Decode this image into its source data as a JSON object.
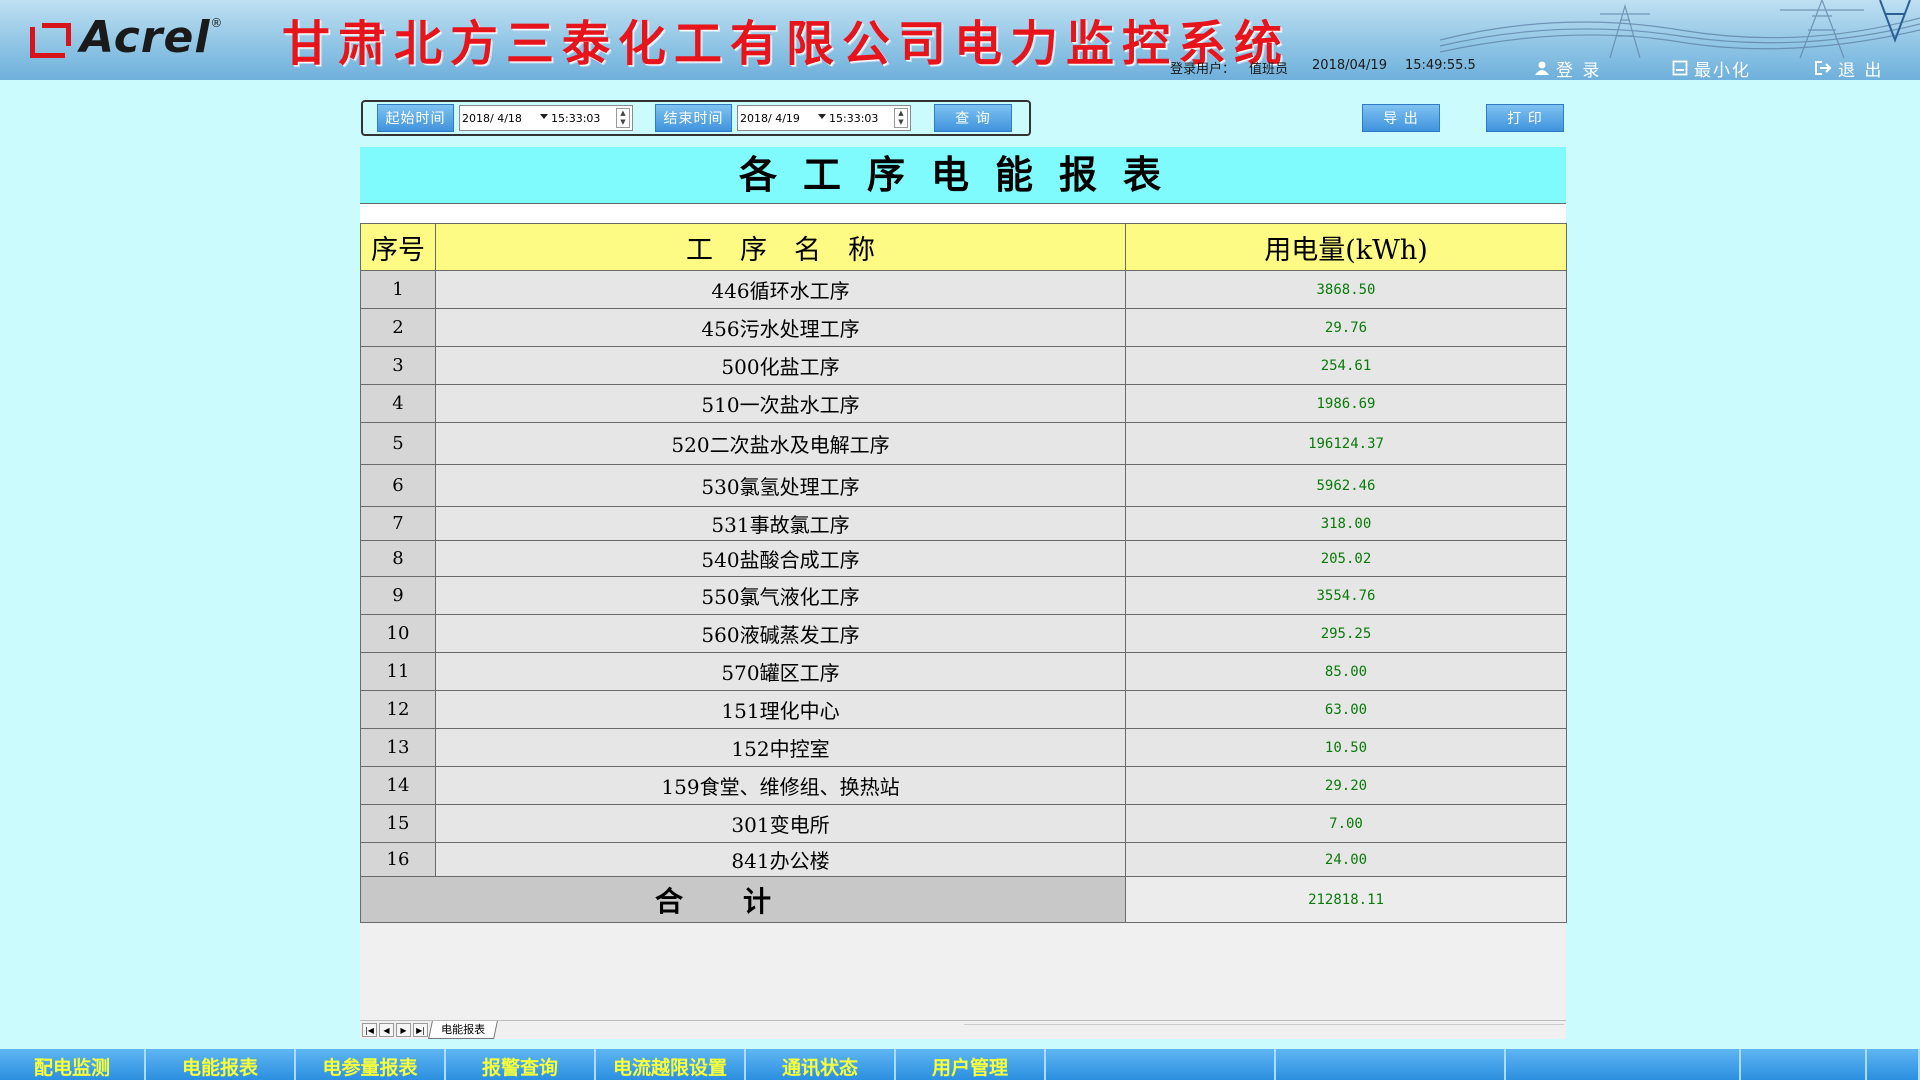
{
  "header": {
    "logo_text": "Acrel",
    "logo_reg": "®",
    "system_title": "甘肃北方三泰化工有限公司电力监控系统",
    "user_label": "登录用户：",
    "user_name": "值班员",
    "date": "2018/04/19",
    "time": "15:49:55.5",
    "login_label": "登 录",
    "minimize_label": "最小化",
    "exit_label": "退 出"
  },
  "toolbar": {
    "start_label": "起始时间",
    "start_date": "2018/ 4/18",
    "start_time": "15:33:03",
    "end_label": "结束时间",
    "end_date": "2018/ 4/19",
    "end_time": "15:33:03",
    "query_label": "查 询",
    "export_label": "导 出",
    "print_label": "打 印"
  },
  "report": {
    "title": "各工序电能报表",
    "headers": [
      "序号",
      "工　序　名　称",
      "用电量(kWh)"
    ],
    "rows": [
      {
        "idx": "1",
        "name": "446循环水工序",
        "value": "3868.50"
      },
      {
        "idx": "2",
        "name": "456污水处理工序",
        "value": "29.76"
      },
      {
        "idx": "3",
        "name": "500化盐工序",
        "value": "254.61"
      },
      {
        "idx": "4",
        "name": "510一次盐水工序",
        "value": "1986.69"
      },
      {
        "idx": "5",
        "name": "520二次盐水及电解工序",
        "value": "196124.37"
      },
      {
        "idx": "6",
        "name": "530氯氢处理工序",
        "value": "5962.46"
      },
      {
        "idx": "7",
        "name": "531事故氯工序",
        "value": "318.00"
      },
      {
        "idx": "8",
        "name": "540盐酸合成工序",
        "value": "205.02"
      },
      {
        "idx": "9",
        "name": "550氯气液化工序",
        "value": "3554.76"
      },
      {
        "idx": "10",
        "name": "560液碱蒸发工序",
        "value": "295.25"
      },
      {
        "idx": "11",
        "name": "570罐区工序",
        "value": "85.00"
      },
      {
        "idx": "12",
        "name": "151理化中心",
        "value": "63.00"
      },
      {
        "idx": "13",
        "name": "152中控室",
        "value": "10.50"
      },
      {
        "idx": "14",
        "name": "159食堂、维修组、换热站",
        "value": "29.20"
      },
      {
        "idx": "15",
        "name": "301变电所",
        "value": "7.00"
      },
      {
        "idx": "16",
        "name": "841办公楼",
        "value": "24.00"
      }
    ],
    "total_label": "合计",
    "total_value": "212818.11",
    "sheet_tab": "电能报表"
  },
  "bottom_nav": [
    "配电监测",
    "电能报表",
    "电参量报表",
    "报警查询",
    "电流越限设置",
    "通讯状态",
    "用户管理",
    "",
    "",
    "",
    "",
    ""
  ],
  "colors": {
    "page_bg": "#ccfbfd",
    "title_red": "#e8141c",
    "report_title_bg": "#7ffbfd",
    "header_row_bg": "#fdfb84",
    "value_green": "#0a7a0a",
    "nav_text": "#f7ff3a"
  }
}
